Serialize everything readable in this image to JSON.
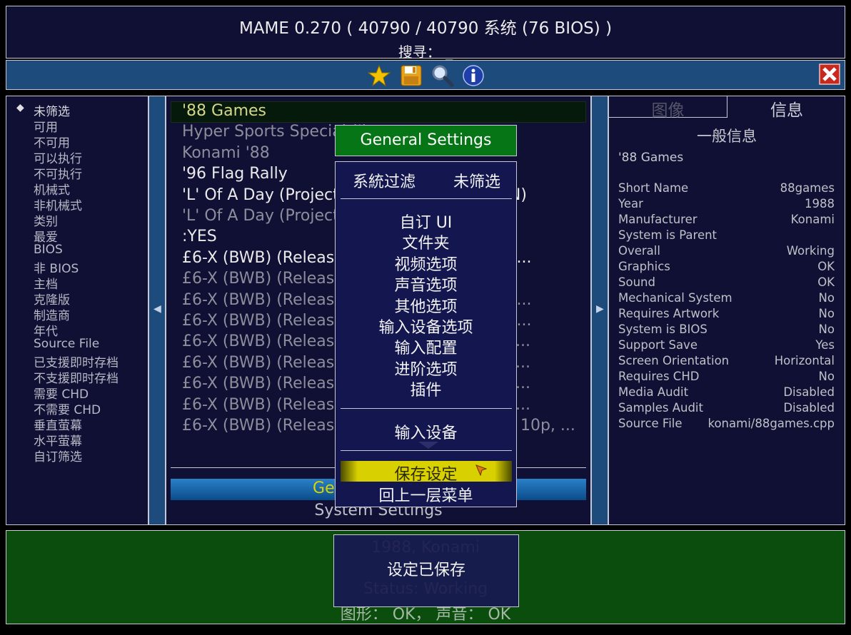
{
  "header": {
    "title": "MAME 0.270 ( 40790 / 40790 系统 (76 BIOS) )",
    "search": "搜寻： _"
  },
  "toolbar": {
    "icons": [
      "star-icon",
      "floppy-disk-icon",
      "magnifier-icon",
      "info-icon"
    ],
    "close_icon": "close-x-icon"
  },
  "filters": [
    "未筛选",
    "可用",
    "不可用",
    "可以执行",
    "不可执行",
    "机械式",
    "非机械式",
    "类别",
    "最爱",
    "BIOS",
    "非 BIOS",
    "主档",
    "克隆版",
    "制造商",
    "年代",
    "Source File",
    "已支援即时存档",
    "不支援即时存档",
    "需要 CHD",
    "不需要 CHD",
    "垂直萤幕",
    "水平萤幕",
    "自订筛选"
  ],
  "games": [
    {
      "name": "'88 Games",
      "available": true
    },
    {
      "name": "Hyper Sports Special (J)",
      "available": false
    },
    {
      "name": "Konami '88",
      "available": false
    },
    {
      "name": "'96 Flag Rally",
      "available": true
    },
    {
      "name": "'L' Of A Day (Project) (Cash set) (PROCONN)",
      "available": true
    },
    {
      "name": "'L' Of A Day (Project) (Token) (PROCONN)",
      "available": false
    },
    {
      "name": ":YES",
      "available": true
    },
    {
      "name": "£6-X (BWB) (Release 3, 200p Cash+Token)...",
      "available": true
    },
    {
      "name": "£6-X (BWB) (Release 3, 200p Cash) (M...",
      "available": false
    },
    {
      "name": "£6-X (BWB) (Release 3, 200p Cash+Token)...",
      "available": false
    },
    {
      "name": "£6-X (BWB) (Release 3, 200p Cash+Token)...",
      "available": false
    },
    {
      "name": "£6-X (BWB) (Release 3, 200p Cash+Token,...",
      "available": false
    },
    {
      "name": "£6-X (BWB) (Release 3, 200p Cash+Token,...",
      "available": false
    },
    {
      "name": "£6-X (BWB) (Release 3, 200p Cash+Token,...",
      "available": false
    },
    {
      "name": "£6-X (BWB) (Release 3, 200p Cash+Token,...",
      "available": false
    },
    {
      "name": "£6-X (BWB) (Release 3, 200p Cash+Token, 10p, ...",
      "available": false
    }
  ],
  "list_footer": {
    "bar_label": "General Settings",
    "sub_label": "System Settings"
  },
  "info_panel": {
    "tabs": [
      "图像",
      "信息"
    ],
    "heading": "一般信息",
    "game": "'88 Games",
    "rows": [
      {
        "key": "Short Name",
        "value": "88games"
      },
      {
        "key": "Year",
        "value": "1988"
      },
      {
        "key": "Manufacturer",
        "value": "Konami"
      },
      {
        "key": "System is Parent",
        "value": ""
      },
      {
        "key": "Overall",
        "value": "Working"
      },
      {
        "key": "Graphics",
        "value": "OK"
      },
      {
        "key": "Sound",
        "value": "OK"
      },
      {
        "key": "Mechanical System",
        "value": "No"
      },
      {
        "key": "Requires Artwork",
        "value": "No"
      },
      {
        "key": "System is BIOS",
        "value": "No"
      },
      {
        "key": "Support Save",
        "value": "Yes"
      },
      {
        "key": "Screen Orientation",
        "value": "Horizontal"
      },
      {
        "key": "Requires CHD",
        "value": "No"
      },
      {
        "key": "Media Audit",
        "value": "Disabled"
      },
      {
        "key": "Samples Audit",
        "value": "Disabled"
      },
      {
        "key": "Source File",
        "value": "konami/88games.cpp"
      }
    ]
  },
  "status": {
    "line1": "1988, Konami",
    "line2": "Status: Working",
    "line3": "图形： OK， 声音： OK"
  },
  "menu": {
    "title": "General Settings",
    "filter_label": "系統过滤",
    "filter_value": "未筛选",
    "items": [
      "自订 UI",
      "文件夹",
      "视频选项",
      "声音选项",
      "其他选项",
      "输入设备选项",
      "输入配置",
      "进阶选项",
      "插件"
    ],
    "input_devices": "输入设备",
    "save": "保存设定",
    "back": "回上一层菜单"
  },
  "toast": "设定已保存"
}
